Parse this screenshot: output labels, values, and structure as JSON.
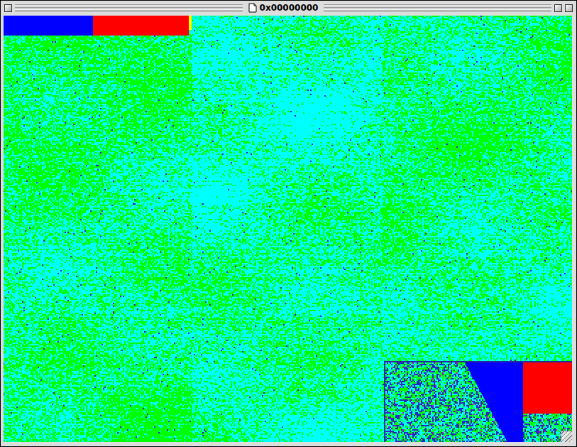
{
  "window": {
    "title": "0x00000000"
  },
  "map": {
    "blocks": [
      {
        "kind": "bar",
        "color": "#0000ff"
      },
      {
        "kind": "bar",
        "color": "#ff0000"
      },
      {
        "kind": "bar",
        "color": "#ffff00"
      },
      {
        "kind": "wedge",
        "color": "#0000ff"
      },
      {
        "kind": "bar",
        "color": "#ff0000"
      }
    ]
  }
}
